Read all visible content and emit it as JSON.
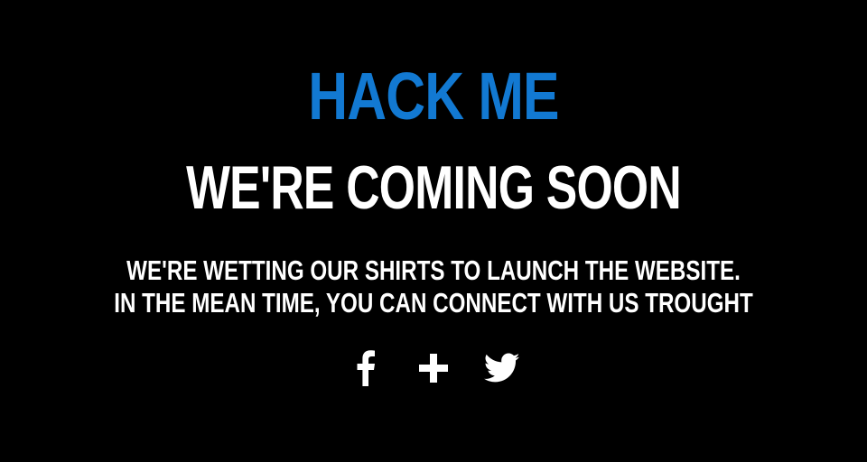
{
  "hero": {
    "brand": "HACK ME",
    "headline": "WE'RE COMING SOON",
    "message_line1": "WE'RE WETTING OUR SHIRTS TO LAUNCH THE WEBSITE.",
    "message_line2": "IN THE MEAN TIME, YOU CAN CONNECT WITH US TROUGHT"
  },
  "social": {
    "links": [
      {
        "icon": "facebook-icon"
      },
      {
        "icon": "google-plus-icon"
      },
      {
        "icon": "twitter-icon"
      }
    ]
  },
  "colors": {
    "background": "#000000",
    "brand": "#1279d2",
    "text": "#ffffff"
  }
}
